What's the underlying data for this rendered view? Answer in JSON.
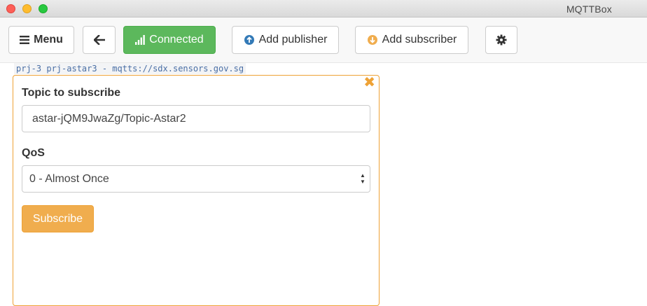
{
  "window": {
    "title": "MQTTBox"
  },
  "toolbar": {
    "menu_label": "Menu",
    "connected_label": "Connected",
    "add_publisher_label": "Add publisher",
    "add_subscriber_label": "Add subscriber"
  },
  "connection": {
    "label": "prj-3 prj-astar3 - mqtts://sdx.sensors.gov.sg"
  },
  "subscriber": {
    "topic_label": "Topic to subscribe",
    "topic_value": "astar-jQM9JwaZg/Topic-Astar2",
    "qos_label": "QoS",
    "qos_selected": "0 - Almost Once",
    "subscribe_label": "Subscribe",
    "close_glyph": "✖"
  },
  "colors": {
    "connected": "#5cb85c",
    "warning": "#f0ad4e",
    "panel_border": "#eea236",
    "label_link": "#4a6fa5"
  }
}
